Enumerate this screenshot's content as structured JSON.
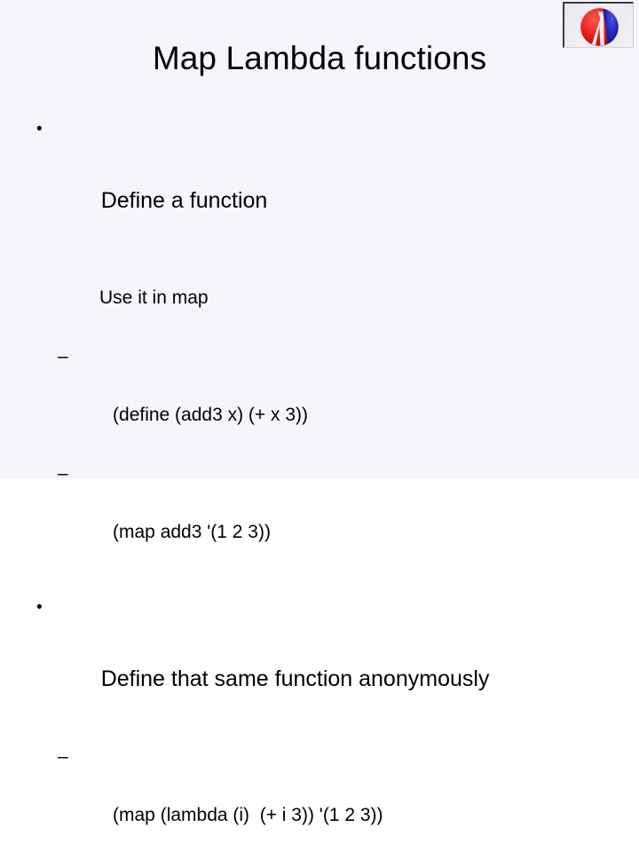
{
  "slide": {
    "title": "Map Lambda functions",
    "background_color": "#f5f6fc",
    "text_color": "#000000"
  },
  "logo": {
    "name": "racket-ball-logo",
    "alt": "Racket / PLT Scheme lambda ball logo",
    "colors": {
      "red": "#e01b1b",
      "blue": "#1b22b8",
      "lambda": "#f7f2ee",
      "frame": "#eeeaf0",
      "border": "#3a3a40"
    }
  },
  "content": {
    "bullet_glyph": "•",
    "dash_glyph": "–",
    "blocks": [
      {
        "level": 1,
        "text": "Define a function"
      },
      {
        "level": 2,
        "marker": "none",
        "text": "Use it in map"
      },
      {
        "level": 2,
        "marker": "dash",
        "text": "(define (add3 x) (+ x 3))"
      },
      {
        "level": 2,
        "marker": "dash",
        "text": "(map add3 '(1 2 3))"
      },
      {
        "level": 1,
        "text": "Define that same function anonymously"
      },
      {
        "level": 2,
        "marker": "dash",
        "text": "(map (lambda (i)  (+ i 3)) '(1 2 3))"
      }
    ]
  }
}
